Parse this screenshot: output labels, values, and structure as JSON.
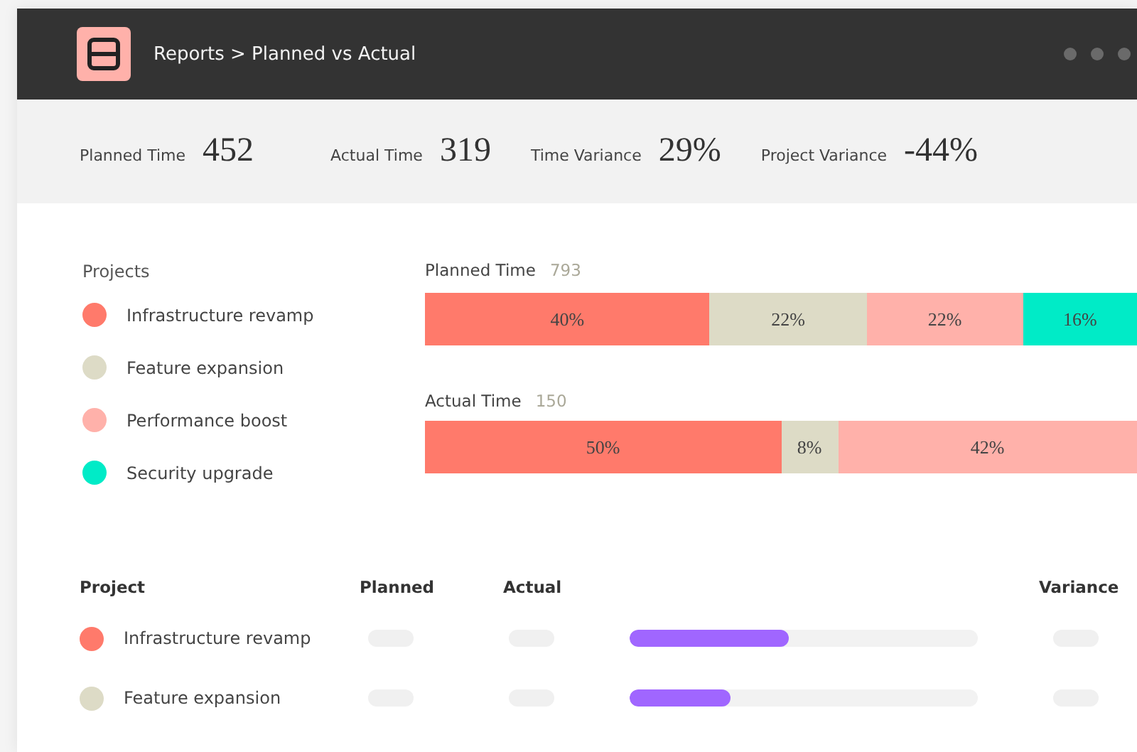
{
  "window": {
    "breadcrumb": "Reports > Planned vs Actual"
  },
  "stats": [
    {
      "label": "Planned Time",
      "value": "452"
    },
    {
      "label": "Actual Time",
      "value": "319"
    },
    {
      "label": "Time Variance",
      "value": "29%"
    },
    {
      "label": "Project Variance",
      "value": "-44%"
    }
  ],
  "legend": {
    "title": "Projects",
    "items": [
      {
        "name": "Infrastructure revamp",
        "color": "#ff7a6b"
      },
      {
        "name": "Feature expansion",
        "color": "#dddbc6"
      },
      {
        "name": "Performance boost",
        "color": "#ffb1aa"
      },
      {
        "name": "Security upgrade",
        "color": "#00ebc7"
      }
    ]
  },
  "bars": [
    {
      "label": "Planned Time",
      "total": "793",
      "segments": [
        {
          "text": "40%",
          "color": "#ff7a6b"
        },
        {
          "text": "22%",
          "color": "#dddbc6"
        },
        {
          "text": "22%",
          "color": "#ffb1aa"
        },
        {
          "text": "16%",
          "color": "#00ebc7"
        }
      ]
    },
    {
      "label": "Actual Time",
      "total": "150",
      "segments": [
        {
          "text": "50%",
          "color": "#ff7a6b"
        },
        {
          "text": "8%",
          "color": "#dddbc6"
        },
        {
          "text": "42%",
          "color": "#ffb1aa"
        }
      ]
    }
  ],
  "table": {
    "columns": [
      "Project",
      "Planned",
      "Actual",
      "Variance"
    ],
    "rows": [
      {
        "name": "Infrastructure revamp",
        "color": "#ff7a6b",
        "level": 0.457
      },
      {
        "name": "Feature expansion",
        "color": "#dddbc6",
        "level": 0.29
      }
    ]
  }
}
